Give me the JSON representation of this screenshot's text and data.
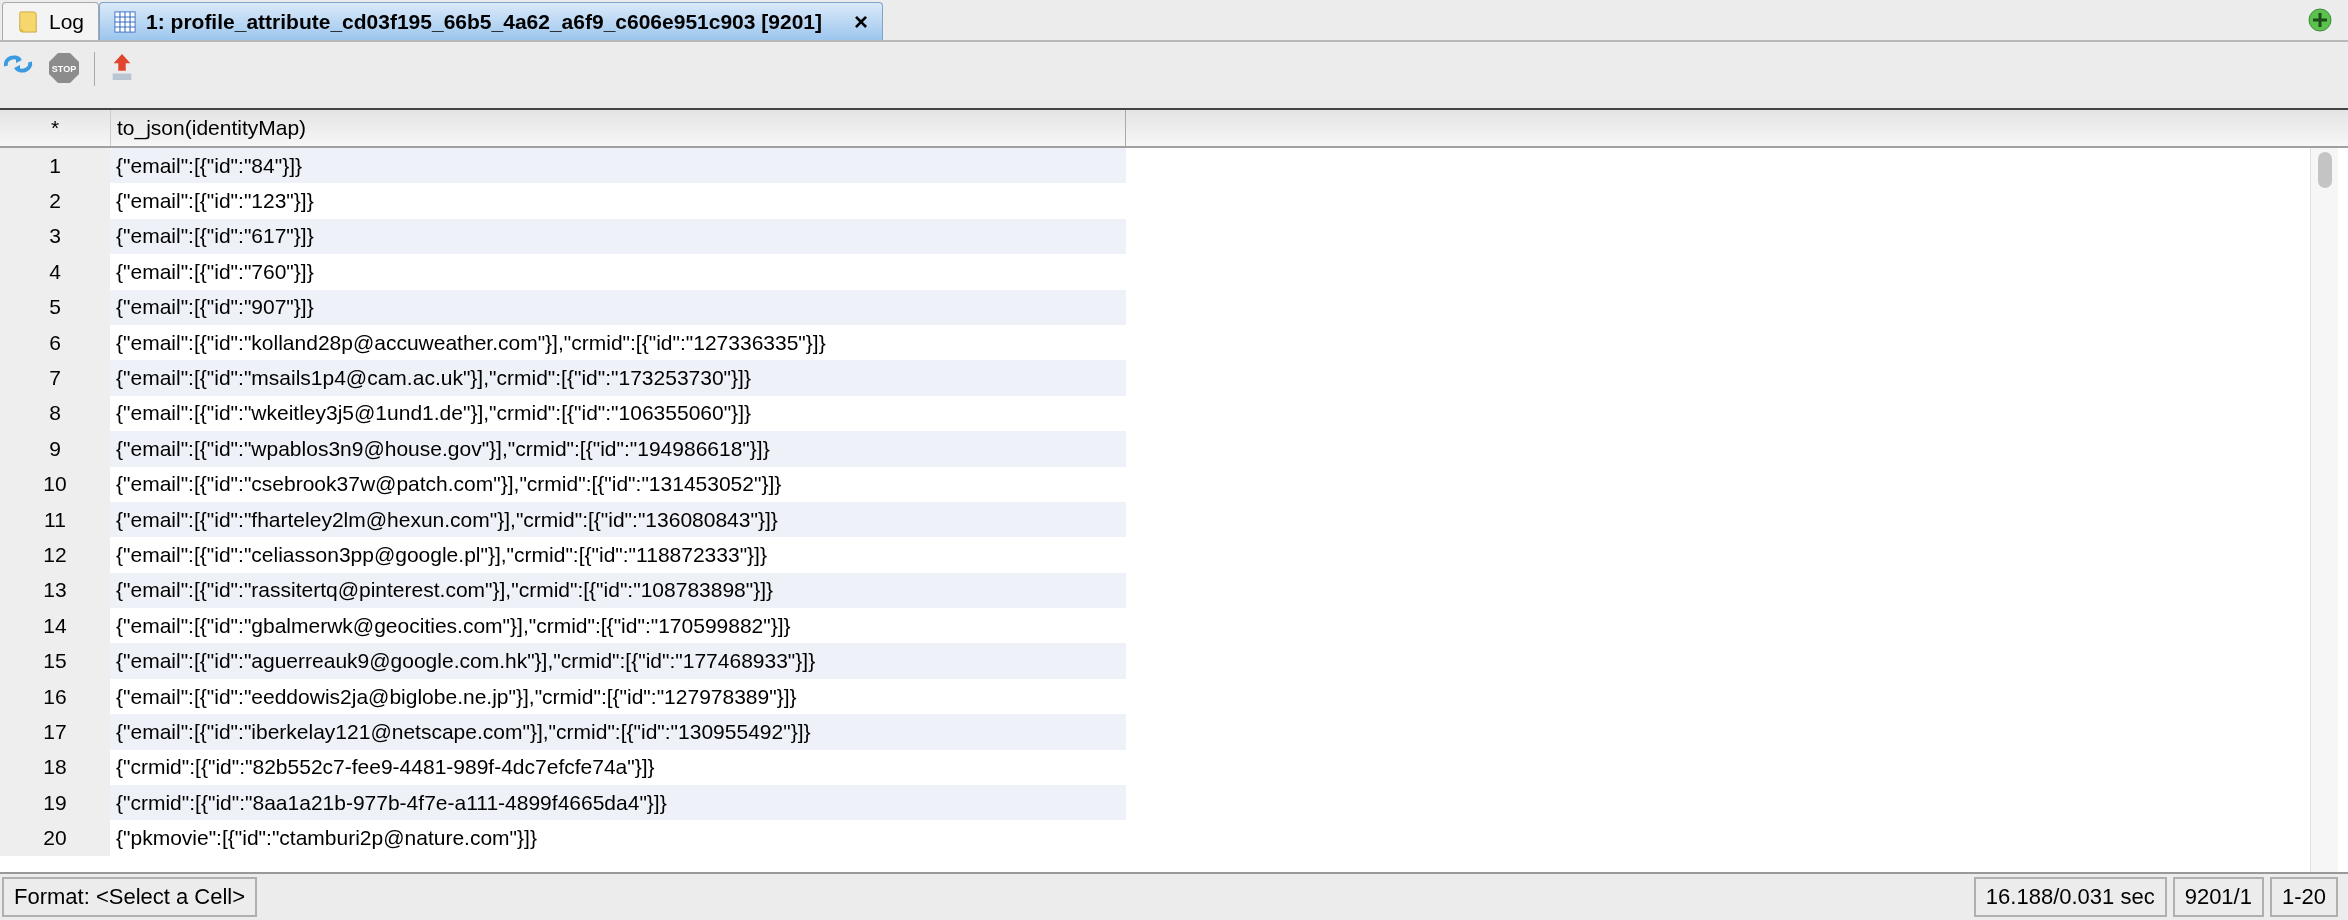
{
  "tabs": [
    {
      "kind": "log",
      "label": "Log",
      "selected": false
    },
    {
      "kind": "table",
      "label": "1: profile_attribute_cd03f195_66b5_4a62_a6f9_c606e951c903 [9201]",
      "selected": true,
      "close_glyph": "×"
    }
  ],
  "toolbar": {
    "stop_label": "STOP"
  },
  "table": {
    "corner": "*",
    "columns": [
      "to_json(identityMap)"
    ],
    "rows": [
      {
        "number": "1",
        "cells": [
          "{\"email\":[{\"id\":\"84\"}]}"
        ]
      },
      {
        "number": "2",
        "cells": [
          "{\"email\":[{\"id\":\"123\"}]}"
        ]
      },
      {
        "number": "3",
        "cells": [
          "{\"email\":[{\"id\":\"617\"}]}"
        ]
      },
      {
        "number": "4",
        "cells": [
          "{\"email\":[{\"id\":\"760\"}]}"
        ]
      },
      {
        "number": "5",
        "cells": [
          "{\"email\":[{\"id\":\"907\"}]}"
        ]
      },
      {
        "number": "6",
        "cells": [
          "{\"email\":[{\"id\":\"kolland28p@accuweather.com\"}],\"crmid\":[{\"id\":\"127336335\"}]}"
        ]
      },
      {
        "number": "7",
        "cells": [
          "{\"email\":[{\"id\":\"msails1p4@cam.ac.uk\"}],\"crmid\":[{\"id\":\"173253730\"}]}"
        ]
      },
      {
        "number": "8",
        "cells": [
          "{\"email\":[{\"id\":\"wkeitley3j5@1und1.de\"}],\"crmid\":[{\"id\":\"106355060\"}]}"
        ]
      },
      {
        "number": "9",
        "cells": [
          "{\"email\":[{\"id\":\"wpablos3n9@house.gov\"}],\"crmid\":[{\"id\":\"194986618\"}]}"
        ]
      },
      {
        "number": "10",
        "cells": [
          "{\"email\":[{\"id\":\"csebrook37w@patch.com\"}],\"crmid\":[{\"id\":\"131453052\"}]}"
        ]
      },
      {
        "number": "11",
        "cells": [
          "{\"email\":[{\"id\":\"fharteley2lm@hexun.com\"}],\"crmid\":[{\"id\":\"136080843\"}]}"
        ]
      },
      {
        "number": "12",
        "cells": [
          "{\"email\":[{\"id\":\"celiasson3pp@google.pl\"}],\"crmid\":[{\"id\":\"118872333\"}]}"
        ]
      },
      {
        "number": "13",
        "cells": [
          "{\"email\":[{\"id\":\"rassitertq@pinterest.com\"}],\"crmid\":[{\"id\":\"108783898\"}]}"
        ]
      },
      {
        "number": "14",
        "cells": [
          "{\"email\":[{\"id\":\"gbalmerwk@geocities.com\"}],\"crmid\":[{\"id\":\"170599882\"}]}"
        ]
      },
      {
        "number": "15",
        "cells": [
          "{\"email\":[{\"id\":\"aguerreauk9@google.com.hk\"}],\"crmid\":[{\"id\":\"177468933\"}]}"
        ]
      },
      {
        "number": "16",
        "cells": [
          "{\"email\":[{\"id\":\"eeddowis2ja@biglobe.ne.jp\"}],\"crmid\":[{\"id\":\"127978389\"}]}"
        ]
      },
      {
        "number": "17",
        "cells": [
          "{\"email\":[{\"id\":\"iberkelay121@netscape.com\"}],\"crmid\":[{\"id\":\"130955492\"}]}"
        ]
      },
      {
        "number": "18",
        "cells": [
          "{\"crmid\":[{\"id\":\"82b552c7-fee9-4481-989f-4dc7efcfe74a\"}]}"
        ]
      },
      {
        "number": "19",
        "cells": [
          "{\"crmid\":[{\"id\":\"8aa1a21b-977b-4f7e-a111-4899f4665da4\"}]}"
        ]
      },
      {
        "number": "20",
        "cells": [
          "{\"pkmovie\":[{\"id\":\"ctamburi2p@nature.com\"}]}"
        ]
      }
    ]
  },
  "status_bar": {
    "format": "Format: <Select a Cell>",
    "timing": "16.188/0.031 sec",
    "count": "9201/1",
    "range": "1-20"
  }
}
